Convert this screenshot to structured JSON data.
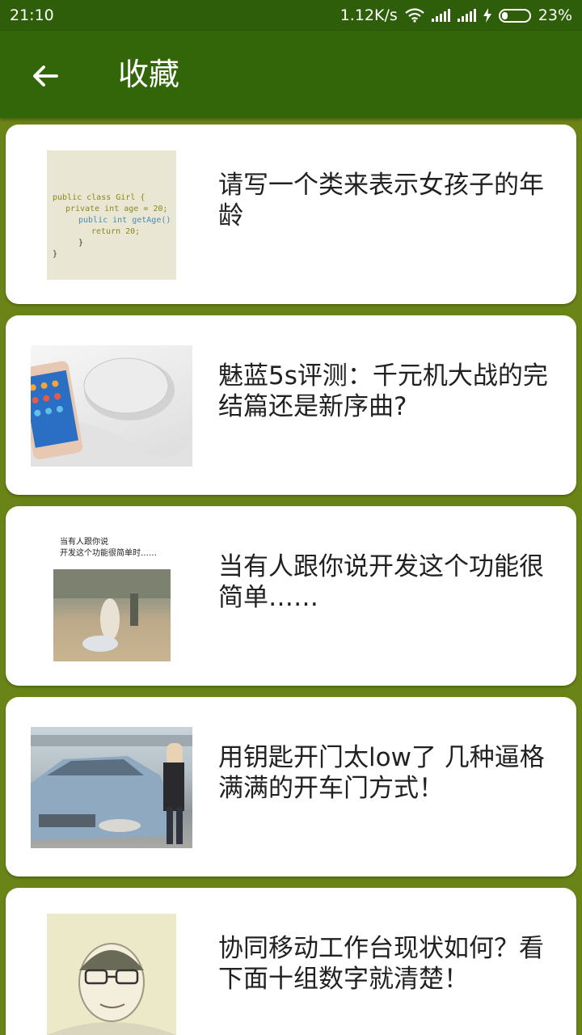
{
  "status": {
    "time": "21:10",
    "speed": "1.12K/s",
    "battery": "23%",
    "battery_level": 0.23
  },
  "appbar": {
    "title": "收藏",
    "back_icon": "arrow-left-icon"
  },
  "favorites": [
    {
      "title": "请写一个类来表示女孩子的年龄",
      "thumb": "code-snippet-image",
      "code": [
        "public class Girl {",
        "private int age = 20;",
        "public int getAge() {",
        "return 20;",
        "}",
        "}"
      ]
    },
    {
      "title": "魅蓝5s评测：千元机大战的完结篇还是新序曲?",
      "thumb": "phone-and-speaker-image"
    },
    {
      "title": "当有人跟你说开发这个功能很简单……",
      "thumb": "meme-image",
      "caption": [
        "当有人跟你说",
        "开发这个功能很简单时……"
      ]
    },
    {
      "title": "用钥匙开门太low了 几种逼格满满的开车门方式！",
      "thumb": "car-and-woman-image"
    },
    {
      "title": "协同移动工作台现状如何？看下面十组数字就清楚！",
      "thumb": "portrait-sketch-image"
    }
  ]
}
